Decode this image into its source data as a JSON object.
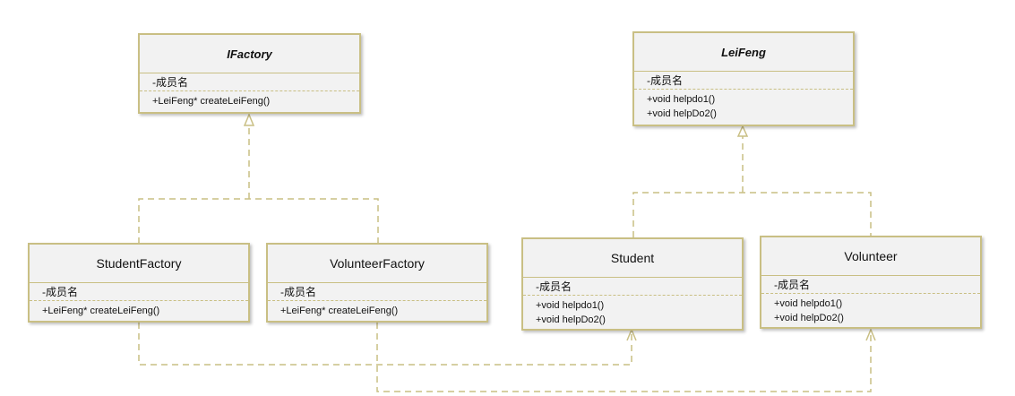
{
  "colors": {
    "border": "#c9bf84",
    "fill": "#f2f2f2",
    "connector": "#c9bf84"
  },
  "classes": {
    "ifactory": {
      "name": "IFactory",
      "attribute": "-成员名",
      "operations": [
        "+LeiFeng* createLeiFeng()"
      ]
    },
    "leifeng": {
      "name": "LeiFeng",
      "attribute": "-成员名",
      "operations": [
        "+void helpdo1()",
        "+void helpDo2()"
      ]
    },
    "student_factory": {
      "name": "StudentFactory",
      "attribute": "-成员名",
      "operations": [
        "+LeiFeng* createLeiFeng()"
      ]
    },
    "volunteer_factory": {
      "name": "VolunteerFactory",
      "attribute": "-成员名",
      "operations": [
        "+LeiFeng* createLeiFeng()"
      ]
    },
    "student": {
      "name": "Student",
      "attribute": "-成员名",
      "operations": [
        "+void helpdo1()",
        "+void helpDo2()"
      ]
    },
    "volunteer": {
      "name": "Volunteer",
      "attribute": "-成员名",
      "operations": [
        "+void helpdo1()",
        "+void helpDo2()"
      ]
    }
  }
}
